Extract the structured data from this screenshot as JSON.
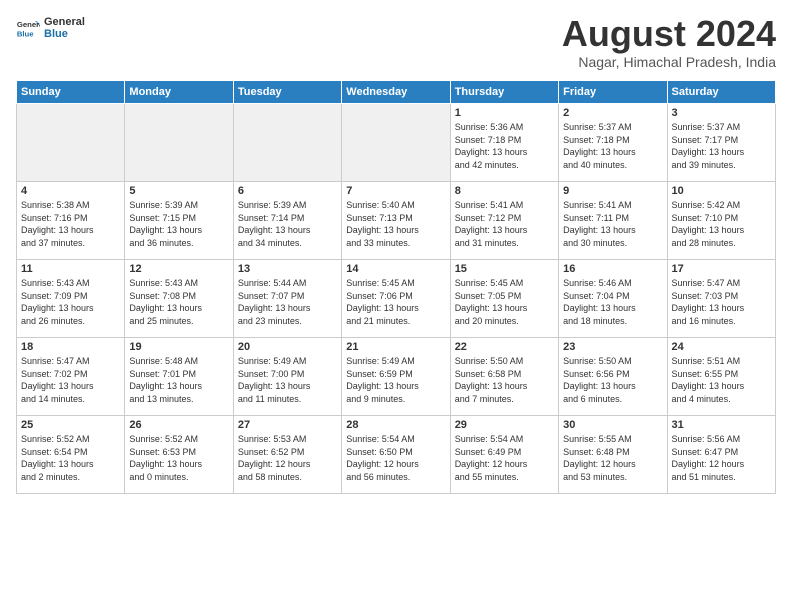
{
  "header": {
    "logo_general": "General",
    "logo_blue": "Blue",
    "month_title": "August 2024",
    "location": "Nagar, Himachal Pradesh, India"
  },
  "columns": [
    "Sunday",
    "Monday",
    "Tuesday",
    "Wednesday",
    "Thursday",
    "Friday",
    "Saturday"
  ],
  "weeks": [
    {
      "days": [
        {
          "num": "",
          "info": ""
        },
        {
          "num": "",
          "info": ""
        },
        {
          "num": "",
          "info": ""
        },
        {
          "num": "",
          "info": ""
        },
        {
          "num": "1",
          "info": "Sunrise: 5:36 AM\nSunset: 7:18 PM\nDaylight: 13 hours\nand 42 minutes."
        },
        {
          "num": "2",
          "info": "Sunrise: 5:37 AM\nSunset: 7:18 PM\nDaylight: 13 hours\nand 40 minutes."
        },
        {
          "num": "3",
          "info": "Sunrise: 5:37 AM\nSunset: 7:17 PM\nDaylight: 13 hours\nand 39 minutes."
        }
      ]
    },
    {
      "days": [
        {
          "num": "4",
          "info": "Sunrise: 5:38 AM\nSunset: 7:16 PM\nDaylight: 13 hours\nand 37 minutes."
        },
        {
          "num": "5",
          "info": "Sunrise: 5:39 AM\nSunset: 7:15 PM\nDaylight: 13 hours\nand 36 minutes."
        },
        {
          "num": "6",
          "info": "Sunrise: 5:39 AM\nSunset: 7:14 PM\nDaylight: 13 hours\nand 34 minutes."
        },
        {
          "num": "7",
          "info": "Sunrise: 5:40 AM\nSunset: 7:13 PM\nDaylight: 13 hours\nand 33 minutes."
        },
        {
          "num": "8",
          "info": "Sunrise: 5:41 AM\nSunset: 7:12 PM\nDaylight: 13 hours\nand 31 minutes."
        },
        {
          "num": "9",
          "info": "Sunrise: 5:41 AM\nSunset: 7:11 PM\nDaylight: 13 hours\nand 30 minutes."
        },
        {
          "num": "10",
          "info": "Sunrise: 5:42 AM\nSunset: 7:10 PM\nDaylight: 13 hours\nand 28 minutes."
        }
      ]
    },
    {
      "days": [
        {
          "num": "11",
          "info": "Sunrise: 5:43 AM\nSunset: 7:09 PM\nDaylight: 13 hours\nand 26 minutes."
        },
        {
          "num": "12",
          "info": "Sunrise: 5:43 AM\nSunset: 7:08 PM\nDaylight: 13 hours\nand 25 minutes."
        },
        {
          "num": "13",
          "info": "Sunrise: 5:44 AM\nSunset: 7:07 PM\nDaylight: 13 hours\nand 23 minutes."
        },
        {
          "num": "14",
          "info": "Sunrise: 5:45 AM\nSunset: 7:06 PM\nDaylight: 13 hours\nand 21 minutes."
        },
        {
          "num": "15",
          "info": "Sunrise: 5:45 AM\nSunset: 7:05 PM\nDaylight: 13 hours\nand 20 minutes."
        },
        {
          "num": "16",
          "info": "Sunrise: 5:46 AM\nSunset: 7:04 PM\nDaylight: 13 hours\nand 18 minutes."
        },
        {
          "num": "17",
          "info": "Sunrise: 5:47 AM\nSunset: 7:03 PM\nDaylight: 13 hours\nand 16 minutes."
        }
      ]
    },
    {
      "days": [
        {
          "num": "18",
          "info": "Sunrise: 5:47 AM\nSunset: 7:02 PM\nDaylight: 13 hours\nand 14 minutes."
        },
        {
          "num": "19",
          "info": "Sunrise: 5:48 AM\nSunset: 7:01 PM\nDaylight: 13 hours\nand 13 minutes."
        },
        {
          "num": "20",
          "info": "Sunrise: 5:49 AM\nSunset: 7:00 PM\nDaylight: 13 hours\nand 11 minutes."
        },
        {
          "num": "21",
          "info": "Sunrise: 5:49 AM\nSunset: 6:59 PM\nDaylight: 13 hours\nand 9 minutes."
        },
        {
          "num": "22",
          "info": "Sunrise: 5:50 AM\nSunset: 6:58 PM\nDaylight: 13 hours\nand 7 minutes."
        },
        {
          "num": "23",
          "info": "Sunrise: 5:50 AM\nSunset: 6:56 PM\nDaylight: 13 hours\nand 6 minutes."
        },
        {
          "num": "24",
          "info": "Sunrise: 5:51 AM\nSunset: 6:55 PM\nDaylight: 13 hours\nand 4 minutes."
        }
      ]
    },
    {
      "days": [
        {
          "num": "25",
          "info": "Sunrise: 5:52 AM\nSunset: 6:54 PM\nDaylight: 13 hours\nand 2 minutes."
        },
        {
          "num": "26",
          "info": "Sunrise: 5:52 AM\nSunset: 6:53 PM\nDaylight: 13 hours\nand 0 minutes."
        },
        {
          "num": "27",
          "info": "Sunrise: 5:53 AM\nSunset: 6:52 PM\nDaylight: 12 hours\nand 58 minutes."
        },
        {
          "num": "28",
          "info": "Sunrise: 5:54 AM\nSunset: 6:50 PM\nDaylight: 12 hours\nand 56 minutes."
        },
        {
          "num": "29",
          "info": "Sunrise: 5:54 AM\nSunset: 6:49 PM\nDaylight: 12 hours\nand 55 minutes."
        },
        {
          "num": "30",
          "info": "Sunrise: 5:55 AM\nSunset: 6:48 PM\nDaylight: 12 hours\nand 53 minutes."
        },
        {
          "num": "31",
          "info": "Sunrise: 5:56 AM\nSunset: 6:47 PM\nDaylight: 12 hours\nand 51 minutes."
        }
      ]
    }
  ]
}
